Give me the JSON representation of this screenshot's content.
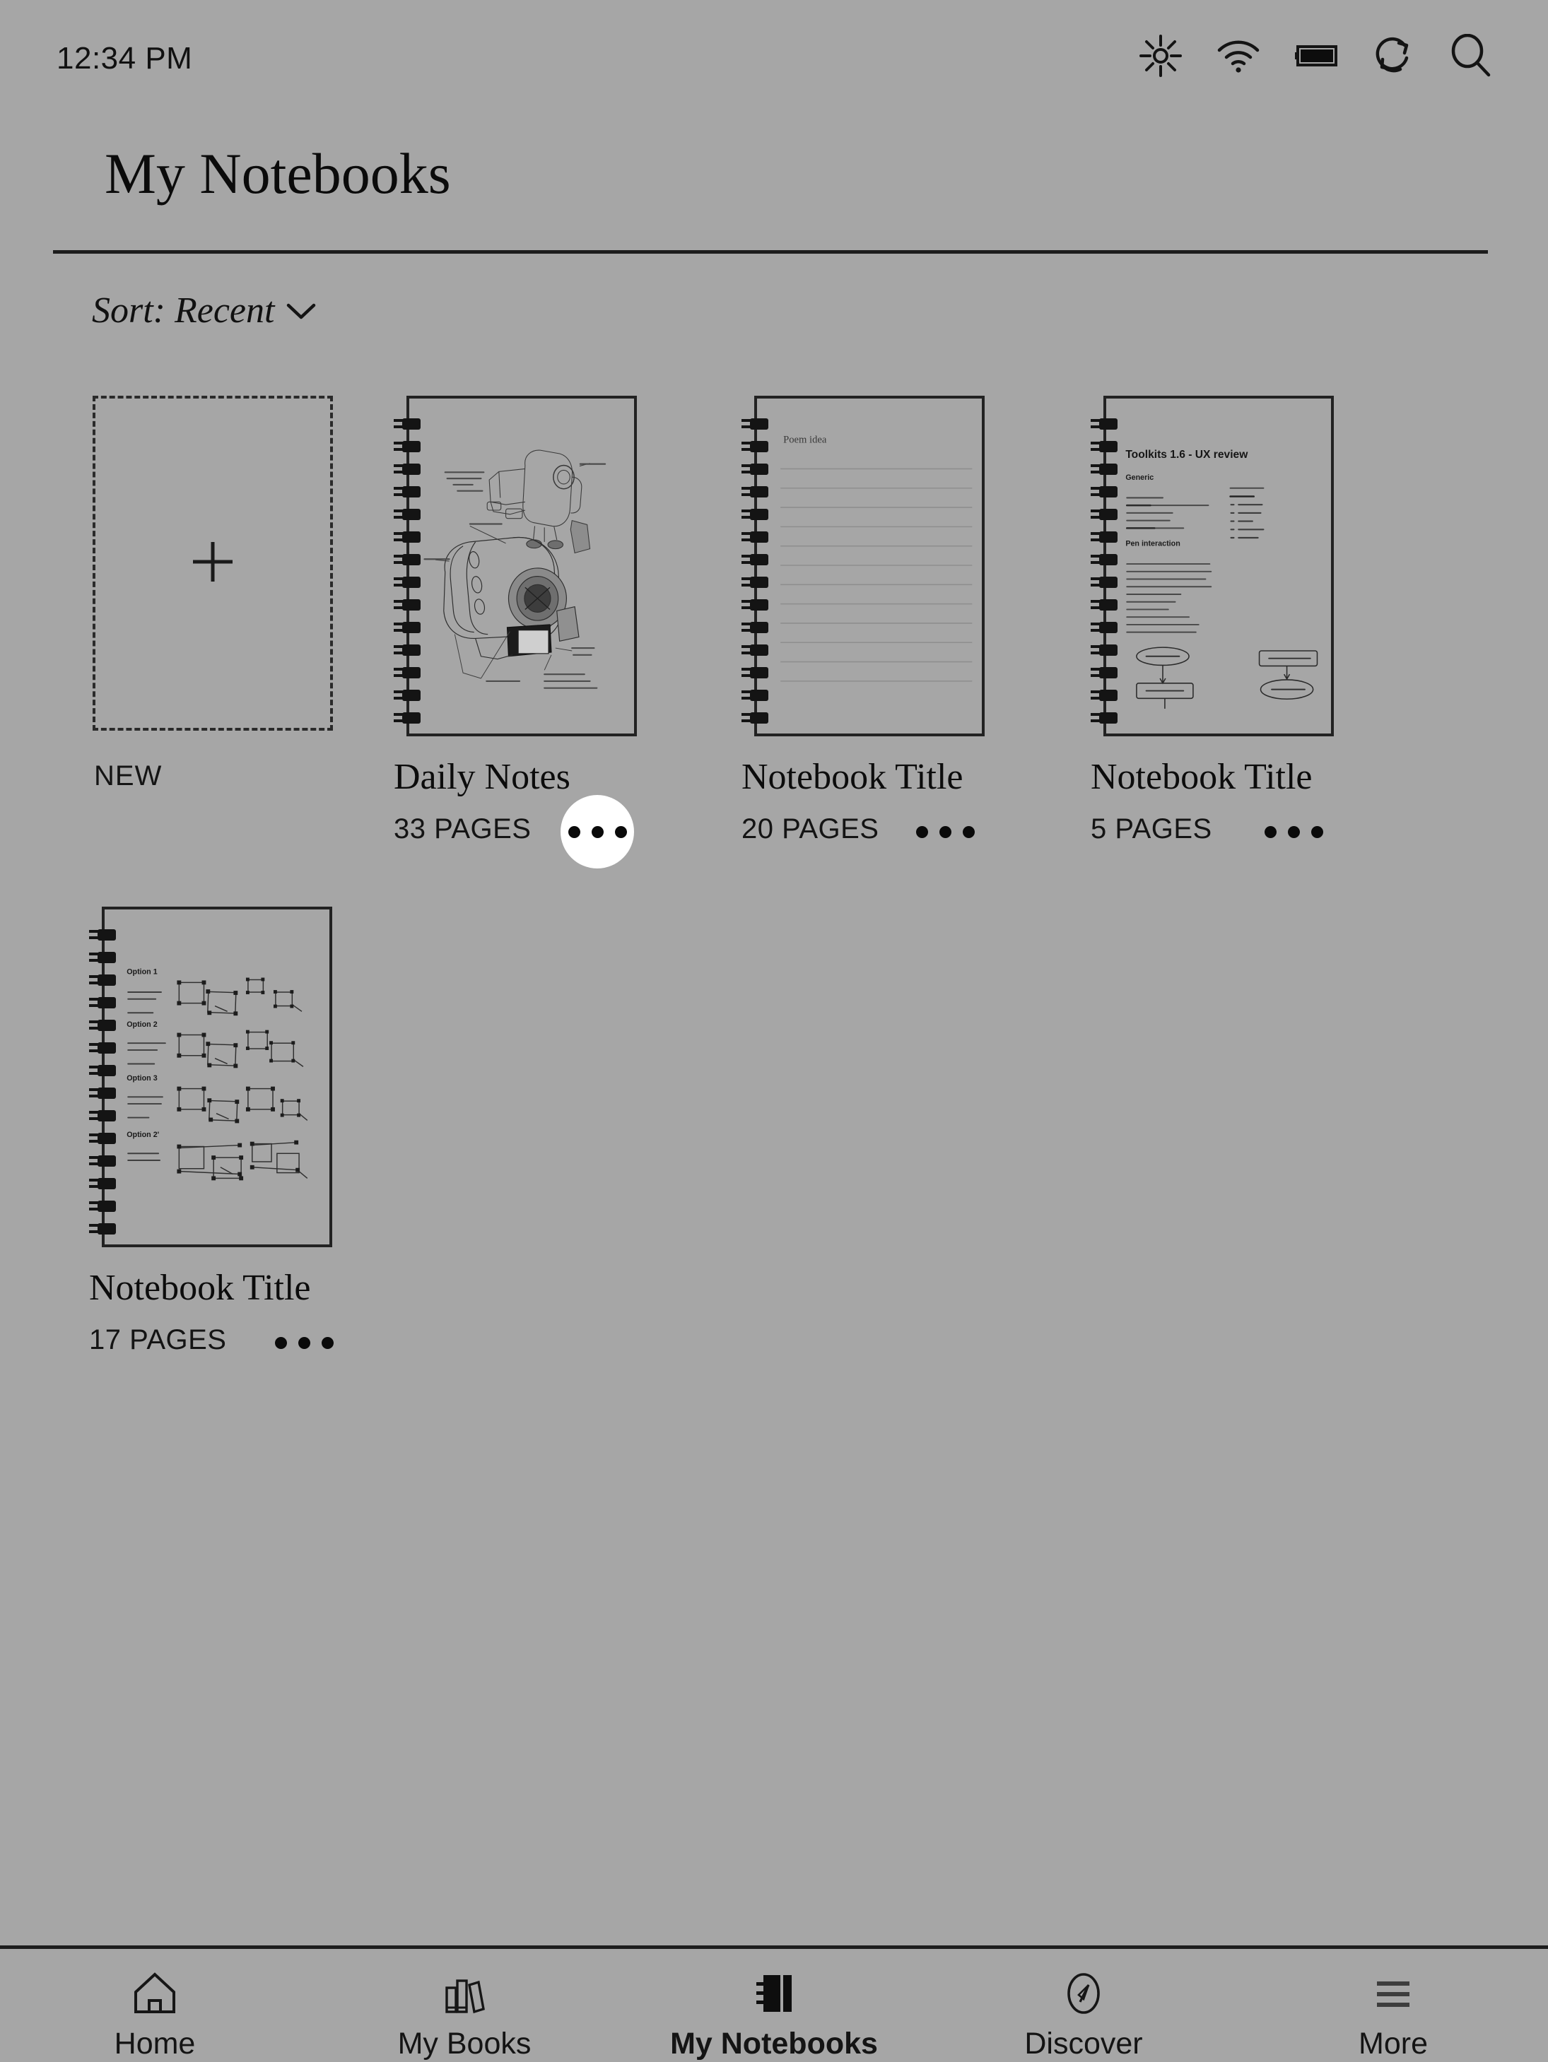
{
  "status_bar": {
    "time": "12:34 PM",
    "icons": [
      {
        "name": "brightness-icon",
        "label": "Brightness"
      },
      {
        "name": "wifi-icon",
        "label": "Wi-Fi"
      },
      {
        "name": "battery-icon",
        "label": "Battery"
      },
      {
        "name": "sync-icon",
        "label": "Sync"
      },
      {
        "name": "search-icon",
        "label": "Search"
      }
    ]
  },
  "header": {
    "title": "My Notebooks"
  },
  "sort": {
    "label": "Sort: Recent",
    "chevron": "chevron-down-icon"
  },
  "new_card": {
    "label": "NEW",
    "icon": "plus-icon"
  },
  "notebooks": [
    {
      "title": "Daily Notes",
      "pages": "33 PAGES",
      "menu": "...",
      "menu_active": true,
      "thumbnail_kind": "sketch-machinery"
    },
    {
      "title": "Notebook Title",
      "pages": "20 PAGES",
      "menu": "...",
      "menu_active": false,
      "thumbnail_kind": "lined-page",
      "thumbnail_heading": "Poem idea"
    },
    {
      "title": "Notebook Title",
      "pages": "5 PAGES",
      "menu": "...",
      "menu_active": false,
      "thumbnail_kind": "ux-review",
      "thumbnail_heading": "Toolkits 1.6 - UX review",
      "thumbnail_sections": [
        "Generic",
        "Pen interaction"
      ]
    },
    {
      "title": "Notebook Title",
      "pages": "17 PAGES",
      "menu": "...",
      "menu_active": false,
      "thumbnail_kind": "wireframe-options",
      "thumbnail_sections": [
        "Option 1",
        "Option 2",
        "Option 3",
        "Option 2'"
      ]
    }
  ],
  "bottom_nav": {
    "items": [
      {
        "label": "Home",
        "icon": "home-icon",
        "active": false
      },
      {
        "label": "My Books",
        "icon": "books-icon",
        "active": false
      },
      {
        "label": "My Notebooks",
        "icon": "notebook-icon",
        "active": true
      },
      {
        "label": "Discover",
        "icon": "compass-icon",
        "active": false
      },
      {
        "label": "More",
        "icon": "hamburger-icon",
        "active": false
      }
    ]
  },
  "colors": {
    "background": "#a6a6a6",
    "ink": "#111111",
    "highlight": "#ffffff",
    "rule": "#1d1d1d"
  }
}
